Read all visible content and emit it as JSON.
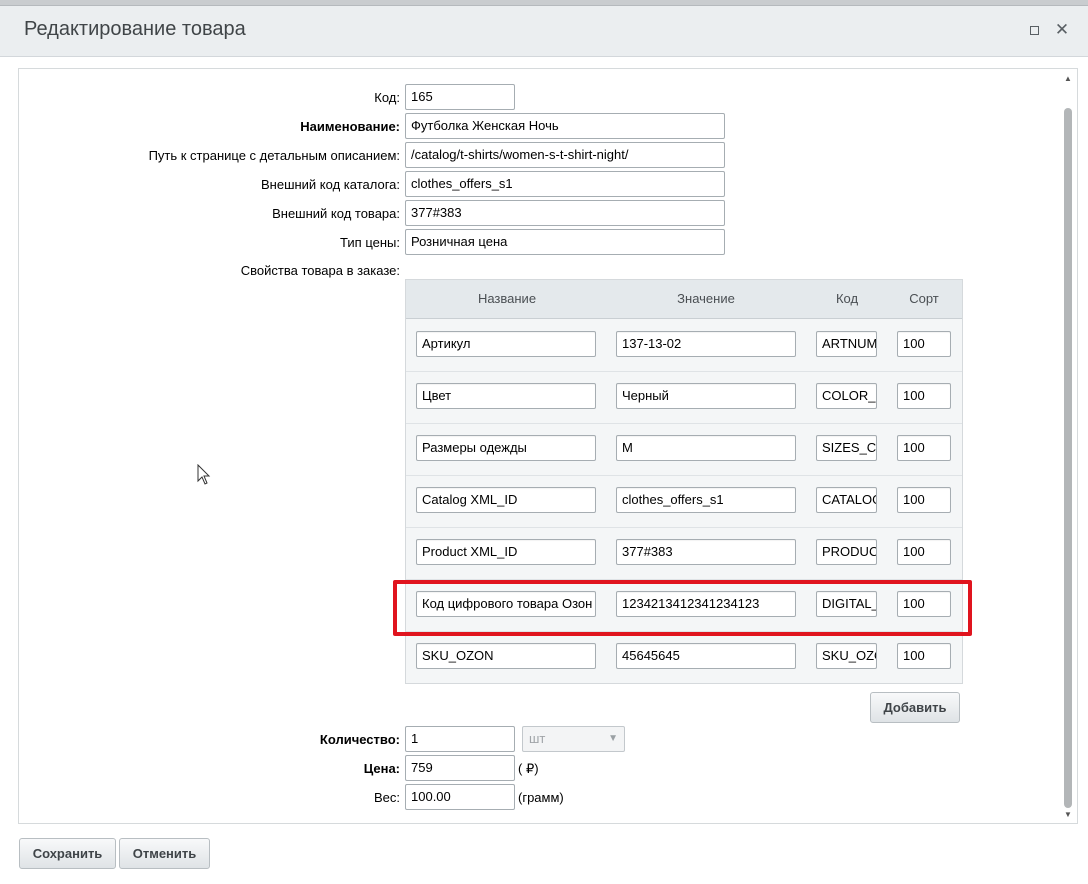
{
  "window": {
    "title": "Редактирование товара",
    "maximize_icon": "maximize-icon",
    "close_icon": "close-icon",
    "close_glyph": "✕"
  },
  "form": {
    "code": {
      "label": "Код:",
      "value": "165"
    },
    "name": {
      "label": "Наименование:",
      "value": "Футболка Женская Ночь"
    },
    "detail_path": {
      "label": "Путь к странице с детальным описанием:",
      "value": "/catalog/t-shirts/women-s-t-shirt-night/"
    },
    "catalog_ext_code": {
      "label": "Внешний код каталога:",
      "value": "clothes_offers_s1"
    },
    "product_ext_code": {
      "label": "Внешний код товара:",
      "value": "377#383"
    },
    "price_type": {
      "label": "Тип цены:",
      "value": "Розничная цена"
    },
    "order_props_label": "Свойства товара в заказе:"
  },
  "props_table": {
    "headers": {
      "name": "Название",
      "value": "Значение",
      "code": "Код",
      "sort": "Сорт"
    },
    "rows": [
      {
        "name": "Артикул",
        "value": "137-13-02",
        "code": "ARTNUMBER",
        "sort": "100"
      },
      {
        "name": "Цвет",
        "value": "Черный",
        "code": "COLOR_REF",
        "sort": "100"
      },
      {
        "name": "Размеры одежды",
        "value": "M",
        "code": "SIZES_CLOTHES",
        "sort": "100"
      },
      {
        "name": "Catalog XML_ID",
        "value": "clothes_offers_s1",
        "code": "CATALOG.XML_ID",
        "sort": "100"
      },
      {
        "name": "Product XML_ID",
        "value": "377#383",
        "code": "PRODUCT.XML_ID",
        "sort": "100"
      },
      {
        "name": "Код цифрового товара Озон",
        "value": "1234213412341234123",
        "code": "DIGITAL_OZON",
        "sort": "100"
      },
      {
        "name": "SKU_OZON",
        "value": "45645645",
        "code": "SKU_OZON",
        "sort": "100"
      }
    ],
    "add_button": "Добавить"
  },
  "quantity": {
    "label": "Количество:",
    "value": "1",
    "unit_select": "шт"
  },
  "price": {
    "label": "Цена:",
    "value": "759",
    "currency": "( ₽)"
  },
  "weight": {
    "label": "Вес:",
    "value": "100.00",
    "unit": "(грамм)"
  },
  "footer": {
    "save": "Сохранить",
    "cancel": "Отменить"
  },
  "colors": {
    "highlight": "#e0141e",
    "title_bar": "#ebeef0"
  }
}
